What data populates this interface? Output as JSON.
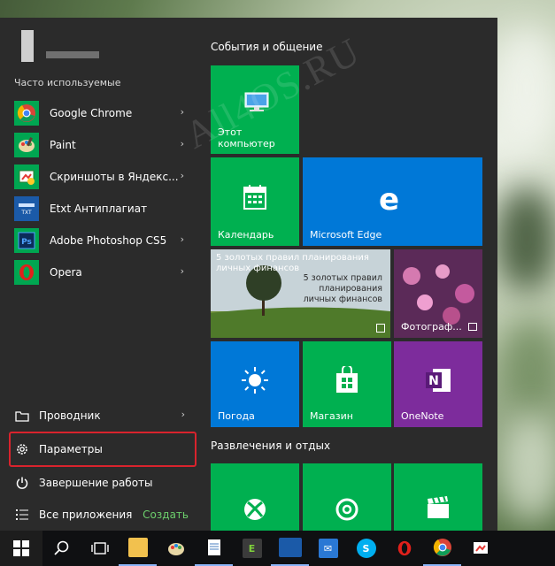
{
  "left": {
    "section_caption": "Часто используемые",
    "apps": [
      {
        "label": "Google Chrome",
        "icon": "chrome-icon",
        "has_arrow": true
      },
      {
        "label": "Paint",
        "icon": "paint-icon",
        "has_arrow": true
      },
      {
        "label": "Скриншоты в Яндекс...",
        "icon": "screenshot-icon",
        "has_arrow": true
      },
      {
        "label": "Etxt Антиплагиат",
        "icon": "etxt-icon",
        "has_arrow": false
      },
      {
        "label": "Adobe Photoshop CS5",
        "icon": "photoshop-icon",
        "has_arrow": true
      },
      {
        "label": "Opera",
        "icon": "opera-icon",
        "has_arrow": true
      }
    ],
    "bottom": {
      "explorer": "Проводник",
      "settings": "Параметры",
      "shutdown": "Завершение работы",
      "all_apps": "Все приложения",
      "create": "Создать"
    }
  },
  "right": {
    "group1_title": "События и общение",
    "group2_title": "Развлечения и отдых",
    "tiles": {
      "this_pc": "Этот\nкомпьютер",
      "calendar": "Календарь",
      "edge": "Microsoft Edge",
      "news_title": "5 золотых правил планирования личных финансов",
      "news_banner": "5 золотых правил\nпланирования\nличных финансов",
      "photos": "Фотограф...",
      "weather": "Погода",
      "store": "Магазин",
      "onenote": "OneNote"
    }
  },
  "watermark": "All4OS.RU",
  "colors": {
    "menu_bg": "#2b2b2b",
    "tile_green": "#00b050",
    "tile_blue": "#0078d7",
    "tile_purple": "#7d2c9c",
    "highlight": "#d9232d",
    "create_link": "#6ccf6c"
  }
}
